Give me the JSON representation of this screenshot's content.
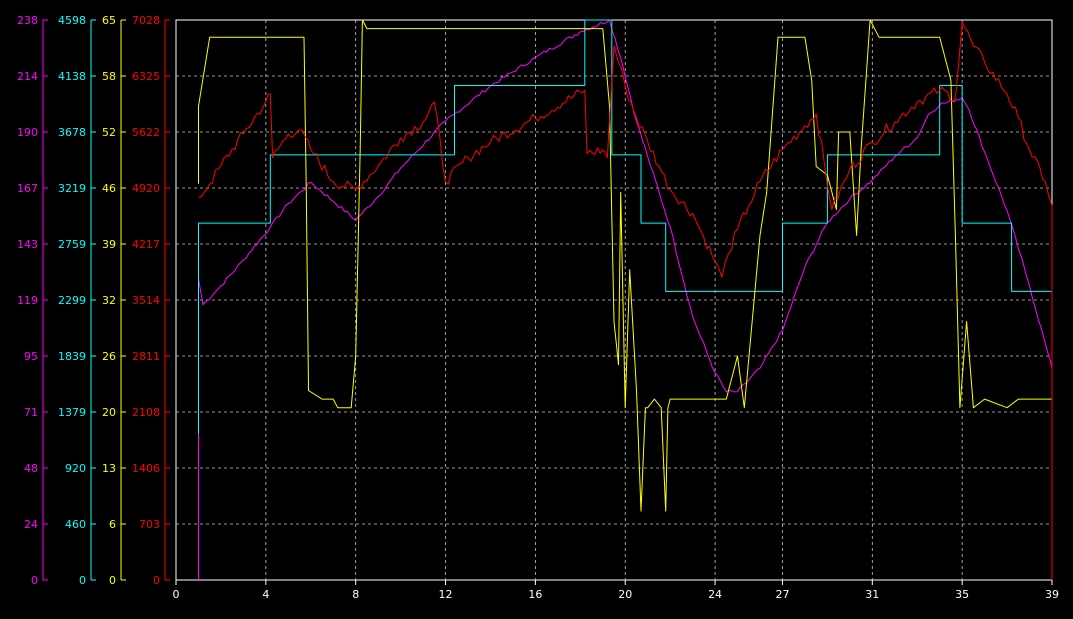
{
  "chart_data": {
    "type": "line",
    "grid": true,
    "background": "#000000",
    "grid_color": "#c8c8c8",
    "x_axis": {
      "range": [
        0,
        39
      ],
      "ticks": [
        0,
        4,
        8,
        12,
        16,
        20,
        24,
        27,
        31,
        35,
        39
      ]
    },
    "y_axes": [
      {
        "color": "#ff00ff",
        "range": [
          0,
          238
        ],
        "ticks": [
          "0",
          "24",
          "48",
          "71",
          "95",
          "119",
          "143",
          "167",
          "190",
          "214",
          "238"
        ]
      },
      {
        "color": "#00ffff",
        "range": [
          0,
          4598
        ],
        "ticks": [
          "0",
          "460",
          "920",
          "1379",
          "1839",
          "2299",
          "2759",
          "3219",
          "3678",
          "4138",
          "4598"
        ]
      },
      {
        "color": "#ffff00",
        "range": [
          0,
          65
        ],
        "ticks": [
          "0",
          "6",
          "13",
          "20",
          "26",
          "32",
          "39",
          "46",
          "52",
          "58",
          "65"
        ]
      },
      {
        "color": "#ff0000",
        "range": [
          0,
          7028
        ],
        "ticks": [
          "0",
          "703",
          "1406",
          "2108",
          "2811",
          "3514",
          "4217",
          "4920",
          "5622",
          "6325",
          "7028"
        ]
      }
    ],
    "series": [
      {
        "axis": 0,
        "color": "#ff00ff",
        "noise": 0.8,
        "points": [
          [
            1,
            0
          ],
          [
            1,
            128
          ],
          [
            1.2,
            117
          ],
          [
            2,
            125
          ],
          [
            3,
            136
          ],
          [
            4.2,
            150
          ],
          [
            5,
            160
          ],
          [
            6,
            169
          ],
          [
            7,
            161
          ],
          [
            8,
            153
          ],
          [
            9,
            163
          ],
          [
            10,
            175
          ],
          [
            12,
            195
          ],
          [
            14,
            210
          ],
          [
            16,
            222
          ],
          [
            18,
            233
          ],
          [
            19.3,
            238
          ],
          [
            19.8,
            222
          ],
          [
            20.5,
            195
          ],
          [
            21,
            180
          ],
          [
            22,
            150
          ],
          [
            23,
            112
          ],
          [
            24,
            88
          ],
          [
            24.5,
            80
          ],
          [
            25,
            80
          ],
          [
            26,
            90
          ],
          [
            27,
            106
          ],
          [
            28,
            133
          ],
          [
            29,
            152
          ],
          [
            30,
            162
          ],
          [
            31,
            170
          ],
          [
            32,
            180
          ],
          [
            33,
            188
          ],
          [
            33.5,
            198
          ],
          [
            34,
            202
          ],
          [
            35,
            205
          ],
          [
            35.3,
            200
          ],
          [
            36,
            182
          ],
          [
            37,
            157
          ],
          [
            38,
            125
          ],
          [
            38.8,
            97
          ],
          [
            39,
            90
          ],
          [
            39,
            0
          ]
        ]
      },
      {
        "axis": 1,
        "color": "#00ffff",
        "noise": 0,
        "points": [
          [
            1,
            1200
          ],
          [
            1,
            2930
          ],
          [
            4.2,
            2930
          ],
          [
            4.2,
            3490
          ],
          [
            12.4,
            3490
          ],
          [
            12.4,
            4060
          ],
          [
            18.2,
            4060
          ],
          [
            18.2,
            4598
          ],
          [
            19.4,
            4598
          ],
          [
            19.4,
            3490
          ],
          [
            20.7,
            3490
          ],
          [
            20.7,
            2930
          ],
          [
            21.8,
            2930
          ],
          [
            21.8,
            2370
          ],
          [
            27,
            2370
          ],
          [
            27,
            2930
          ],
          [
            29,
            2930
          ],
          [
            29,
            3490
          ],
          [
            34,
            3490
          ],
          [
            34,
            4060
          ],
          [
            35,
            4060
          ],
          [
            35,
            2930
          ],
          [
            37.2,
            2930
          ],
          [
            37.2,
            2370
          ],
          [
            39,
            2370
          ],
          [
            39,
            1000
          ]
        ]
      },
      {
        "axis": 2,
        "color": "#ffff00",
        "noise": 0,
        "points": [
          [
            1,
            46
          ],
          [
            1,
            55
          ],
          [
            1.5,
            63
          ],
          [
            5.7,
            63
          ],
          [
            5.8,
            45
          ],
          [
            5.9,
            22
          ],
          [
            6.5,
            21
          ],
          [
            7,
            21
          ],
          [
            7.2,
            20
          ],
          [
            7.8,
            20
          ],
          [
            8,
            26
          ],
          [
            8.2,
            50
          ],
          [
            8.3,
            65
          ],
          [
            8.5,
            64
          ],
          [
            17,
            64
          ],
          [
            18.5,
            64
          ],
          [
            18.7,
            64
          ],
          [
            19,
            64
          ],
          [
            19.3,
            55
          ],
          [
            19.5,
            30
          ],
          [
            19.7,
            25
          ],
          [
            19.8,
            45
          ],
          [
            20,
            20
          ],
          [
            20.2,
            36
          ],
          [
            20.5,
            22
          ],
          [
            20.7,
            8
          ],
          [
            20.9,
            20
          ],
          [
            21,
            20
          ],
          [
            21.3,
            21
          ],
          [
            21.6,
            20
          ],
          [
            21.8,
            8
          ],
          [
            21.9,
            20
          ],
          [
            22,
            21
          ],
          [
            24.5,
            21
          ],
          [
            25,
            26
          ],
          [
            25.3,
            20
          ],
          [
            26,
            40
          ],
          [
            26.3,
            45
          ],
          [
            26.8,
            63
          ],
          [
            28,
            63
          ],
          [
            28.3,
            58
          ],
          [
            28.5,
            48
          ],
          [
            29,
            47
          ],
          [
            29.2,
            45
          ],
          [
            29.4,
            43
          ],
          [
            29.5,
            52
          ],
          [
            30,
            52
          ],
          [
            30.3,
            40
          ],
          [
            30.5,
            50
          ],
          [
            30.9,
            65
          ],
          [
            31.3,
            63
          ],
          [
            34,
            63
          ],
          [
            34.5,
            58
          ],
          [
            34.7,
            40
          ],
          [
            34.9,
            20
          ],
          [
            35.2,
            30
          ],
          [
            35.5,
            20
          ],
          [
            36,
            21
          ],
          [
            37,
            20
          ],
          [
            37.5,
            21
          ],
          [
            39,
            21
          ],
          [
            39,
            10
          ]
        ]
      },
      {
        "axis": 3,
        "color": "#ff0000",
        "noise": 70,
        "points": [
          [
            1,
            4800
          ],
          [
            1.5,
            4970
          ],
          [
            2,
            5200
          ],
          [
            3,
            5600
          ],
          [
            4,
            6000
          ],
          [
            4.2,
            6100
          ],
          [
            4.3,
            5300
          ],
          [
            5,
            5600
          ],
          [
            5.5,
            5650
          ],
          [
            6,
            5400
          ],
          [
            7,
            5000
          ],
          [
            8,
            4900
          ],
          [
            9,
            5200
          ],
          [
            10,
            5550
          ],
          [
            11,
            5750
          ],
          [
            11.5,
            6000
          ],
          [
            12,
            5000
          ],
          [
            13,
            5300
          ],
          [
            14,
            5500
          ],
          [
            16,
            5800
          ],
          [
            18.2,
            6150
          ],
          [
            18.3,
            5350
          ],
          [
            19,
            5400
          ],
          [
            19.2,
            5300
          ],
          [
            19.5,
            6700
          ],
          [
            19.7,
            6500
          ],
          [
            20,
            6200
          ],
          [
            20.5,
            5800
          ],
          [
            21,
            5500
          ],
          [
            21.5,
            5200
          ],
          [
            22,
            4900
          ],
          [
            23,
            4600
          ],
          [
            23.5,
            4300
          ],
          [
            24,
            4000
          ],
          [
            24.3,
            3800
          ],
          [
            24.6,
            4100
          ],
          [
            25,
            4400
          ],
          [
            25.5,
            4700
          ],
          [
            26,
            5000
          ],
          [
            27,
            5400
          ],
          [
            28,
            5700
          ],
          [
            28.5,
            5850
          ],
          [
            29.2,
            4650
          ],
          [
            30,
            5150
          ],
          [
            31,
            5500
          ],
          [
            32,
            5750
          ],
          [
            33,
            6000
          ],
          [
            34,
            6150
          ],
          [
            34.7,
            6050
          ],
          [
            35,
            7000
          ],
          [
            35.5,
            6700
          ],
          [
            36,
            6500
          ],
          [
            37,
            6100
          ],
          [
            37.5,
            5800
          ],
          [
            38,
            5400
          ],
          [
            38.7,
            5000
          ],
          [
            39,
            4700
          ],
          [
            39,
            0
          ]
        ]
      }
    ]
  }
}
